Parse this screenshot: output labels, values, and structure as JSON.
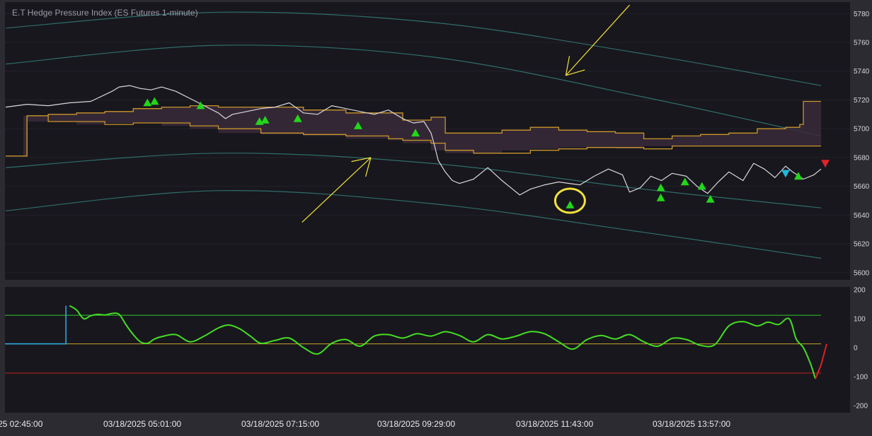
{
  "title": "E.T Hedge Pressure Index (ES Futures 1-minute)",
  "colors": {
    "background": "#2b2b31",
    "panel": "#18171d",
    "price_line": "#d8d8dc",
    "band_line": "#c9962a",
    "band_fill": "#3a2a3a",
    "envelope": "#2e6e6a",
    "buy_marker": "#22d61a",
    "sell_marker": "#e0242a",
    "cyan_marker": "#22b8d8",
    "osc_green": "#44dd22",
    "osc_blue": "#2aa8e0",
    "osc_red": "#dd2020",
    "level_upper": "#2ec82e",
    "level_mid": "#c8a82a",
    "level_lower": "#c02020",
    "annotation": "#f3e23a"
  },
  "time_axis": {
    "labels": [
      "25 02:45:00",
      "03/18/2025 05:01:00",
      "03/18/2025 07:15:00",
      "03/18/2025 09:29:00",
      "03/18/2025 11:43:00",
      "03/18/2025 13:57:00"
    ]
  },
  "chart_data": [
    {
      "type": "line",
      "panel": "price",
      "title": "E.T Hedge Pressure Index (ES Futures 1-minute)",
      "ylim": [
        5595,
        5788
      ],
      "yticks": [
        5780,
        5760,
        5740,
        5720,
        5700,
        5680,
        5660,
        5640,
        5620,
        5600
      ],
      "x_range": [
        0,
        1150
      ],
      "series": [
        {
          "role": "price",
          "x": [
            0,
            30,
            60,
            90,
            120,
            150,
            160,
            175,
            190,
            205,
            220,
            240,
            260,
            280,
            300,
            310,
            320,
            340,
            360,
            380,
            400,
            420,
            440,
            460,
            480,
            500,
            520,
            540,
            560,
            575,
            590,
            600,
            605,
            610,
            620,
            630,
            640,
            660,
            680,
            700,
            715,
            725,
            740,
            760,
            780,
            795,
            810,
            830,
            850,
            870,
            880,
            895,
            910,
            925,
            940,
            960,
            975,
            990,
            1005,
            1020,
            1040,
            1055,
            1070,
            1085,
            1100,
            1110,
            1125,
            1140,
            1150
          ],
          "values": [
            5715,
            5717,
            5716,
            5718,
            5719,
            5726,
            5729,
            5730,
            5728,
            5727,
            5729,
            5726,
            5721,
            5716,
            5711,
            5707,
            5710,
            5712,
            5714,
            5715,
            5718,
            5711,
            5710,
            5716,
            5714,
            5712,
            5710,
            5713,
            5707,
            5704,
            5705,
            5697,
            5688,
            5678,
            5670,
            5664,
            5662,
            5665,
            5673,
            5664,
            5658,
            5654,
            5658,
            5661,
            5663,
            5662,
            5661,
            5667,
            5672,
            5668,
            5656,
            5659,
            5667,
            5664,
            5669,
            5667,
            5660,
            5655,
            5663,
            5670,
            5664,
            5676,
            5672,
            5666,
            5674,
            5670,
            5665,
            5668,
            5672
          ]
        },
        {
          "role": "band_upper",
          "x": [
            0,
            25,
            30,
            60,
            100,
            140,
            180,
            220,
            260,
            300,
            360,
            420,
            480,
            540,
            560,
            600,
            620,
            660,
            700,
            740,
            780,
            820,
            860,
            900,
            940,
            980,
            1020,
            1060,
            1100,
            1120,
            1125,
            1150
          ],
          "values": [
            5681,
            5681,
            5709,
            5710,
            5711,
            5712,
            5714,
            5715,
            5716,
            5715,
            5715,
            5713,
            5711,
            5711,
            5706,
            5708,
            5697,
            5697,
            5699,
            5701,
            5699,
            5698,
            5697,
            5693,
            5695,
            5696,
            5697,
            5700,
            5701,
            5703,
            5719,
            5719
          ]
        },
        {
          "role": "band_lower",
          "x": [
            0,
            25,
            30,
            60,
            100,
            140,
            180,
            220,
            260,
            300,
            360,
            420,
            480,
            540,
            560,
            600,
            620,
            660,
            700,
            740,
            780,
            820,
            860,
            900,
            940,
            980,
            1020,
            1060,
            1100,
            1120,
            1125,
            1150
          ],
          "values": [
            5681,
            5681,
            5709,
            5705,
            5705,
            5703,
            5704,
            5704,
            5702,
            5700,
            5697,
            5696,
            5695,
            5693,
            5692,
            5690,
            5685,
            5683,
            5683,
            5685,
            5686,
            5687,
            5687,
            5686,
            5688,
            5688,
            5688,
            5688,
            5688,
            5688,
            5688,
            5688
          ]
        },
        {
          "role": "envelope_outer_upper",
          "x": [
            0,
            300,
            600,
            900,
            1150
          ],
          "values": [
            5770,
            5781,
            5774,
            5752,
            5730
          ]
        },
        {
          "role": "envelope_inner_upper",
          "x": [
            0,
            300,
            600,
            900,
            1150
          ],
          "values": [
            5745,
            5758,
            5750,
            5722,
            5695
          ]
        },
        {
          "role": "envelope_inner_lower",
          "x": [
            0,
            300,
            600,
            900,
            1150
          ],
          "values": [
            5673,
            5683,
            5676,
            5658,
            5645
          ]
        },
        {
          "role": "envelope_outer_lower",
          "x": [
            0,
            300,
            600,
            900,
            1150
          ],
          "values": [
            5643,
            5657,
            5648,
            5628,
            5610
          ]
        }
      ],
      "markers": {
        "buy_up": [
          {
            "x": 200,
            "y": 5718
          },
          {
            "x": 210,
            "y": 5719
          },
          {
            "x": 275,
            "y": 5716
          },
          {
            "x": 358,
            "y": 5705
          },
          {
            "x": 366,
            "y": 5706
          },
          {
            "x": 412,
            "y": 5707
          },
          {
            "x": 497,
            "y": 5702
          },
          {
            "x": 578,
            "y": 5697
          },
          {
            "x": 796,
            "y": 5647
          },
          {
            "x": 924,
            "y": 5652
          },
          {
            "x": 924,
            "y": 5659
          },
          {
            "x": 958,
            "y": 5663
          },
          {
            "x": 982,
            "y": 5660
          },
          {
            "x": 994,
            "y": 5651
          },
          {
            "x": 1118,
            "y": 5667
          }
        ],
        "cyan_down": [
          {
            "x": 1100,
            "y": 5669
          }
        ],
        "sell_down": [
          {
            "x": 1156,
            "y": 5676
          }
        ]
      },
      "annotations": {
        "arrows": [
          {
            "from": [
              880,
              5786
            ],
            "to": [
              790,
              5737
            ]
          },
          {
            "from": [
              418,
              5635
            ],
            "to": [
              515,
              5680
            ]
          }
        ],
        "circle": {
          "x": 796,
          "y": 5650
        }
      }
    },
    {
      "type": "line",
      "panel": "oscillator",
      "ylim": [
        -225,
        210
      ],
      "yticks": [
        200,
        100,
        0,
        -100,
        -200
      ],
      "x_range": [
        0,
        1150
      ],
      "levels": [
        {
          "role": "upper",
          "value": 112
        },
        {
          "role": "mid",
          "value": 13
        },
        {
          "role": "lower",
          "value": -88
        }
      ],
      "series": [
        {
          "role": "blue",
          "x": [
            0,
            85,
            90
          ],
          "values": [
            13,
            13,
            145
          ]
        },
        {
          "role": "green",
          "x": [
            90,
            100,
            110,
            120,
            130,
            140,
            150,
            160,
            170,
            180,
            190,
            200,
            210,
            220,
            240,
            260,
            280,
            300,
            315,
            330,
            345,
            360,
            380,
            400,
            420,
            440,
            460,
            480,
            500,
            520,
            540,
            560,
            580,
            600,
            620,
            640,
            660,
            680,
            700,
            720,
            740,
            760,
            780,
            800,
            820,
            840,
            860,
            880,
            900,
            920,
            940,
            960,
            980,
            1000,
            1020,
            1040,
            1060,
            1075,
            1090,
            1105,
            1115,
            1125,
            1135,
            1142
          ],
          "values": [
            145,
            130,
            100,
            110,
            115,
            113,
            118,
            115,
            78,
            45,
            20,
            15,
            30,
            38,
            45,
            20,
            40,
            68,
            78,
            65,
            40,
            15,
            25,
            33,
            0,
            -22,
            15,
            28,
            5,
            40,
            45,
            33,
            48,
            40,
            55,
            42,
            20,
            45,
            30,
            40,
            55,
            48,
            20,
            -5,
            28,
            42,
            30,
            45,
            20,
            5,
            32,
            28,
            8,
            10,
            75,
            90,
            75,
            88,
            80,
            100,
            30,
            0,
            -55,
            -108
          ]
        },
        {
          "role": "red",
          "x": [
            1142,
            1150,
            1158
          ],
          "values": [
            -108,
            -60,
            13
          ]
        }
      ]
    }
  ]
}
